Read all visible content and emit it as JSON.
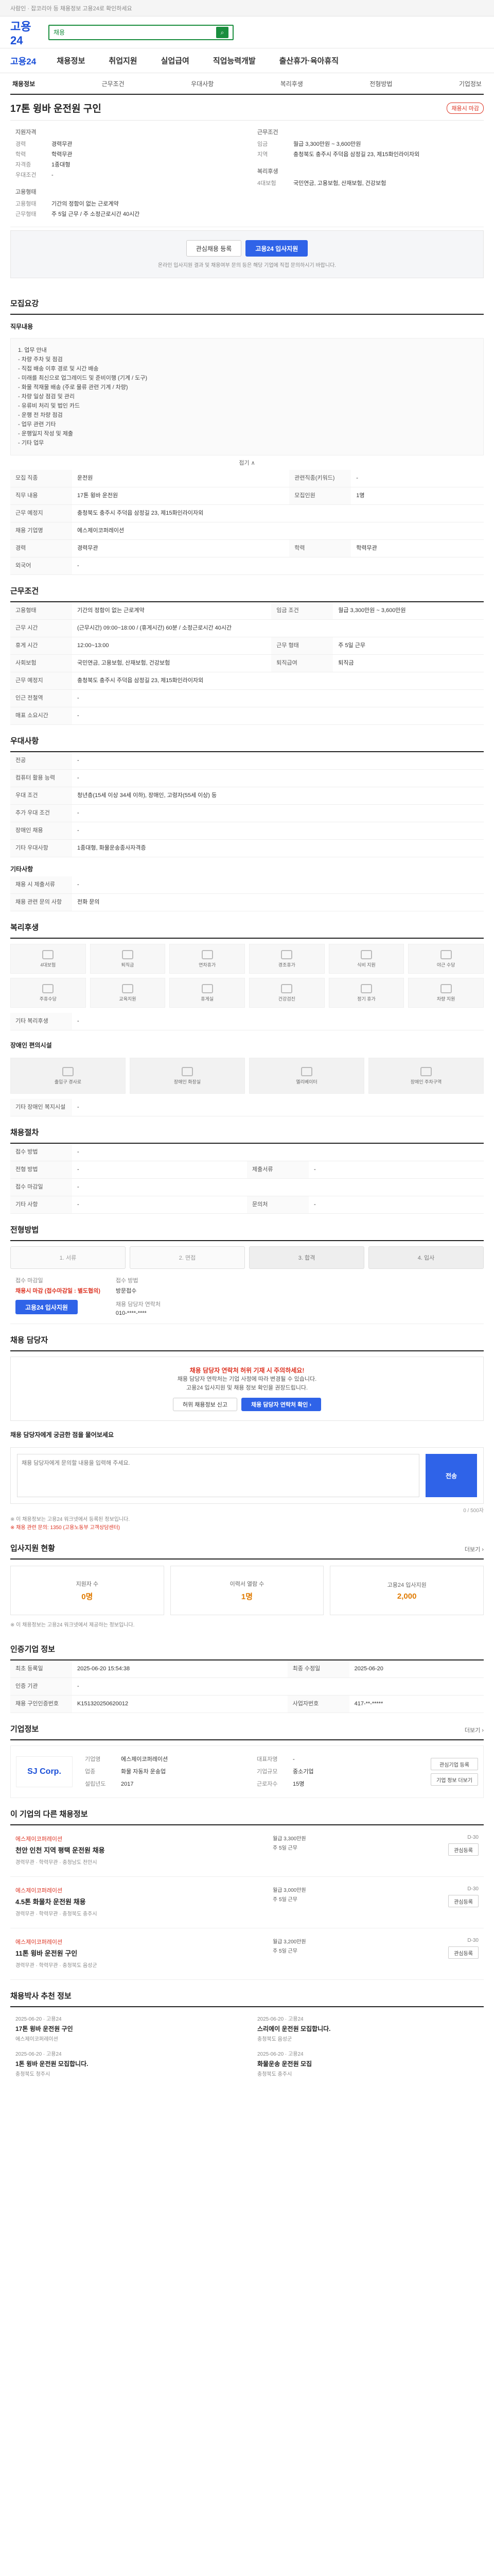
{
  "topbar": {
    "notice": "사람인 · 잡코리아 등 채용정보 고용24로 확인하세요"
  },
  "header": {
    "logo": "고용24",
    "search_placeholder": "채용"
  },
  "gnb": {
    "brand": "고용24",
    "items": [
      "채용정보",
      "취업지원",
      "실업급여",
      "직업능력개발",
      "출산휴가·육아휴직"
    ]
  },
  "tabs": [
    "채용정보",
    "근무조건",
    "우대사항",
    "복리후생",
    "전형방법",
    "기업정보"
  ],
  "job": {
    "title": "17톤 윙바 운전원 구인",
    "badge": "채용시 마감",
    "left_heading": "지원자격",
    "left": [
      {
        "k": "경력",
        "v": "경력무관"
      },
      {
        "k": "학력",
        "v": "학력무관"
      },
      {
        "k": "자격증",
        "v": "1종대형"
      },
      {
        "k": "우대조건",
        "v": "-"
      }
    ],
    "left2_heading": "고용형태",
    "left2": [
      {
        "k": "고용형태",
        "v": "기간의 정함이 없는 근로계약"
      },
      {
        "k": "근무형태",
        "v": "주 5일 근무 / 주 소정근로시간 40시간"
      }
    ],
    "right_heading": "근무조건",
    "right": [
      {
        "k": "임금",
        "v": "월급 3,300만원 ~ 3,600만원"
      },
      {
        "k": "지역",
        "v": "충청북도 충주시 주덕읍 삼정길 23, 제15화인라이자외"
      }
    ],
    "right2_heading": "복리후생",
    "right2": [
      {
        "k": "4대보험",
        "v": "국민연금, 고용보험, 산재보험, 건강보험"
      }
    ]
  },
  "apply": {
    "scrap": "관심채용 등록",
    "apply": "고용24 입사지원",
    "note": "온라인 입사지원 결과 및 채용여부 문의 등은 해당 기업에 직접 문의하시기 바랍니다."
  },
  "recruit": {
    "title": "모집요강",
    "duty_label": "직무내용",
    "desc": "1. 업무 안내\n - 차량 주차 및 점검\n - 직접 배송 이후 경로 및 시간 배송\n - 미래를 최신으로 업그레이드 및 준비이행 (기계 / 도구)\n - 화물 적재물 배송 (주로 물류 관련 기계 / 차량)\n - 차량 일상 점검 및 관리\n - 유류비 처리 및 법인 카드\n - 운행 전 차량 점검\n - 업무 관련 기타\n - 운행일지 작성 및 제출\n - 기타 업무",
    "fold": "접기 ∧",
    "rows": [
      {
        "k": "모집 직종",
        "v": "운전원",
        "k2": "관련직종(키워드)",
        "v2": "-"
      },
      {
        "k": "직무 내용",
        "v": "17톤 윙바 운전원",
        "k2": "모집인원",
        "v2": "1명"
      },
      {
        "k": "근무 예정지",
        "v": "충청북도 충주시 주덕읍 삼정길 23, 제15화인라이자외",
        "k2": "",
        "v2": ""
      },
      {
        "k": "채용 기업명",
        "v": "에스제이코퍼레이션",
        "k2": "",
        "v2": ""
      },
      {
        "k": "경력",
        "v": "경력무관",
        "k2": "학력",
        "v2": "학력무관"
      },
      {
        "k": "외국어",
        "v": "-",
        "k2": "",
        "v2": ""
      }
    ]
  },
  "conditions": {
    "title": "근무조건",
    "rows": [
      {
        "k": "고용형태",
        "v": "기간의 정함이 없는 근로계약",
        "k2": "임금 조건",
        "v2": "월급 3,300만원 ~ 3,600만원"
      },
      {
        "k": "근무 시간",
        "v": "(근무시간) 09:00~18:00 / (휴게시간) 60분 / 소정근로시간 40시간",
        "k2": "",
        "v2": ""
      },
      {
        "k": "휴게 시간",
        "v": "12:00~13:00",
        "k2": "근무 형태",
        "v2": "주 5일 근무"
      },
      {
        "k": "사회보험",
        "v": "국민연금, 고용보험, 산재보험, 건강보험",
        "k2": "퇴직급여",
        "v2": "퇴직금"
      },
      {
        "k": "근무 예정지",
        "v": "충청북도 충주시 주덕읍 삼정길 23, 제15화인라이자외",
        "k2": "",
        "v2": ""
      },
      {
        "k": "인근 전철역",
        "v": "-",
        "k2": "",
        "v2": ""
      },
      {
        "k": "매표 소요시간",
        "v": "-",
        "k2": "",
        "v2": ""
      }
    ]
  },
  "prefer": {
    "title": "우대사항",
    "rows": [
      {
        "k": "전공",
        "v": "-"
      },
      {
        "k": "컴퓨터 활용 능력",
        "v": "-"
      },
      {
        "k": "우대 조건",
        "v": "청년층(15세 이상 34세 이하), 장애인, 고령자(55세 이상) 등"
      },
      {
        "k": "추가 우대 조건",
        "v": "-"
      },
      {
        "k": "장애인 채용",
        "v": "-"
      },
      {
        "k": "기타 우대사항",
        "v": "1종대형, 화물운송종사자격증"
      }
    ],
    "extra_title": "기타사항",
    "extra_rows": [
      {
        "k": "채용 시 제출서류",
        "v": "-"
      },
      {
        "k": "채용 관련 문의 사항",
        "v": "전화 문의"
      }
    ]
  },
  "welfare": {
    "title": "복리후생",
    "items": [
      "4대보험",
      "퇴직금",
      "연차휴가",
      "경조휴가",
      "식비 지원",
      "야근 수당",
      "주휴수당",
      "교육지원",
      "휴게실",
      "건강검진",
      "정기 휴가",
      "차량 지원"
    ],
    "sub": "기타 복리후생",
    "sub_value": "-",
    "facility_title": "장애인 편의시설",
    "facility": [
      "출입구 경사로",
      "장애인 화장실",
      "엘리베이터",
      "장애인 주차구역"
    ],
    "facility_sub": "기타 장애인 복지시설",
    "facility_sub_value": "-"
  },
  "process_title": "채용절차",
  "process_rows": [
    {
      "k": "접수 방법",
      "v": "-"
    },
    {
      "k": "전형 방법",
      "v": "-",
      "k2": "제출서류",
      "v2": "-"
    },
    {
      "k": "접수 마감일",
      "v": "-"
    },
    {
      "k": "기타 사항",
      "v": "-",
      "k2": "문의처",
      "v2": "-"
    }
  ],
  "steps": {
    "title": "전형방법",
    "items": [
      "1. 서류",
      "2. 면접",
      "3. 합격 ",
      "4. 입사 "
    ]
  },
  "method": {
    "receipt_label": "접수 마감일",
    "receipt_value": "채용시 마감 (접수마감일 : 별도협의)",
    "apply_label": "접수 방법",
    "apply_value": "방문접수",
    "apply_btn": "고용24 입사지원",
    "phone_label": "채용 담당자 연락처",
    "phone_value": "010-****-****"
  },
  "safety": {
    "title": "채용 담당자",
    "red": "채용 담당자 연락처 허위 기재 시 주의하세요!",
    "line1": "채용 담당자 연락처는 기업 사정에 따라 변경될 수 있습니다.",
    "line2": "고용24 입사지원 및 채용 정보 확인을 권장드립니다.",
    "btn1": "허위 채용정보 신고",
    "btn2": "채용 담당자 연락처 확인 ›"
  },
  "memo": {
    "title": "채용 담당자에게 궁금한 점을 물어보세요",
    "placeholder": "채용 담당자에게 문의할 내용을 입력해 주세요.",
    "btn": "전송",
    "count": "0 / 500자",
    "note1": "※ 이 채용정보는 고용24 워크넷에서 등록된 정보입니다.",
    "note2": "※ 채용 관련 문의: 1350 (고용노동부 고객상담센터)"
  },
  "stats": {
    "title": "입사지원 현황",
    "more": "더보기 ›",
    "cards": [
      {
        "label": "지원자 수",
        "value": "0명"
      },
      {
        "label": "이력서 열람 수",
        "value": "1명"
      },
      {
        "label": "고용24 입사지원",
        "value": "2,000"
      }
    ],
    "note": "※ 이 채용정보는 고용24 워크넷에서 제공하는 정보입니다."
  },
  "meta": {
    "title": "인증기업 정보",
    "rows": [
      {
        "k": "최초 등록일",
        "v": "2025-06-20 15:54:38",
        "k2": "최종 수정일",
        "v2": "2025-06-20"
      },
      {
        "k": "인증 기관",
        "v": "-",
        "k2": "",
        "v2": ""
      },
      {
        "k": "채용 구인인증번호",
        "v": "K151320250620012",
        "k2": "사업자번호",
        "v2": "417-**-*****"
      }
    ]
  },
  "company": {
    "title": "기업정보",
    "more": "더보기 ›",
    "logo": "SJ Corp.",
    "rows": [
      {
        "k": "기업명",
        "v": "에스제이코퍼레이션"
      },
      {
        "k": "대표자명",
        "v": "-"
      },
      {
        "k": "업종",
        "v": "화물 자동차 운송업"
      },
      {
        "k": "기업규모",
        "v": "중소기업"
      },
      {
        "k": "설립년도",
        "v": "2017"
      },
      {
        "k": "근로자수",
        "v": "15명"
      }
    ],
    "btn1": "관심기업 등록",
    "btn2": "기업 정보 더보기"
  },
  "similar": {
    "title": "이 기업의 다른 채용정보",
    "jobs": [
      {
        "co": "에스제이코퍼레이션",
        "t": "천안 인천 지역 평택 운전원 채용",
        "m": "경력무관 · 학력무관 · 충청남도 천안시",
        "c1": "월급 3,300만원",
        "c2": "주 5일 근무",
        "r": "D-30"
      },
      {
        "co": "에스제이코퍼레이션",
        "t": "4.5톤 화물차 운전원 채용",
        "m": "경력무관 · 학력무관 · 충청북도 충주시",
        "c1": "월급 3,000만원",
        "c2": "주 5일 근무",
        "r": "D-30"
      },
      {
        "co": "에스제이코퍼레이션",
        "t": "11톤 윙바 운전원 구인",
        "m": "경력무관 · 학력무관 · 충청북도 음성군",
        "c1": "월급 3,200만원",
        "c2": "주 5일 근무",
        "r": "D-30"
      }
    ],
    "btn": "관심등록"
  },
  "blog": {
    "title": "채용박사 추천 정보",
    "items": [
      {
        "s": "2025-06-20 · 고용24",
        "t": "17톤 윙바 운전원 구인",
        "d": "에스제이코퍼레이션"
      },
      {
        "s": "2025-06-20 · 고용24",
        "t": "스리에이 운전원 모집합니다.",
        "d": "충청북도 음성군"
      },
      {
        "s": "2025-06-20 · 고용24",
        "t": "1톤 윙바 운전원 모집합니다.",
        "d": "충청북도 청주시"
      },
      {
        "s": "2025-06-20 · 고용24",
        "t": "화물운송 운전원 모집",
        "d": "충청북도 충주시"
      }
    ]
  }
}
